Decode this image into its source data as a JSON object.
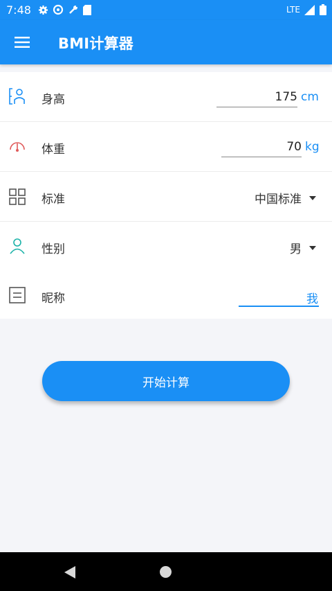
{
  "status_bar": {
    "time": "7:48",
    "network": "LTE",
    "icons_left": [
      "gear-icon",
      "data-saver-icon",
      "wrench-icon",
      "sd-card-icon"
    ],
    "icons_right": [
      "signal-icon",
      "battery-icon"
    ]
  },
  "app_bar": {
    "menu_icon": "menu-icon",
    "title": "BMI计算器"
  },
  "form": {
    "height": {
      "label": "身高",
      "value": "175",
      "unit": "cm",
      "icon": "height-icon"
    },
    "weight": {
      "label": "体重",
      "value": "70",
      "unit": "kg",
      "icon": "gauge-icon"
    },
    "standard": {
      "label": "标准",
      "selected": "中国标准",
      "icon": "grid-icon"
    },
    "gender": {
      "label": "性别",
      "selected": "男",
      "icon": "person-icon"
    },
    "nickname": {
      "label": "昵称",
      "value": "我",
      "icon": "note-icon"
    }
  },
  "actions": {
    "start_label": "开始计算"
  },
  "colors": {
    "primary": "#1a8ff5",
    "background": "#f4f5f9",
    "weight_icon": "#e05a5a",
    "gender_icon": "#1bb2a8"
  },
  "nav_bar": {
    "back_icon": "back-triangle-icon",
    "home_icon": "home-circle-icon"
  }
}
